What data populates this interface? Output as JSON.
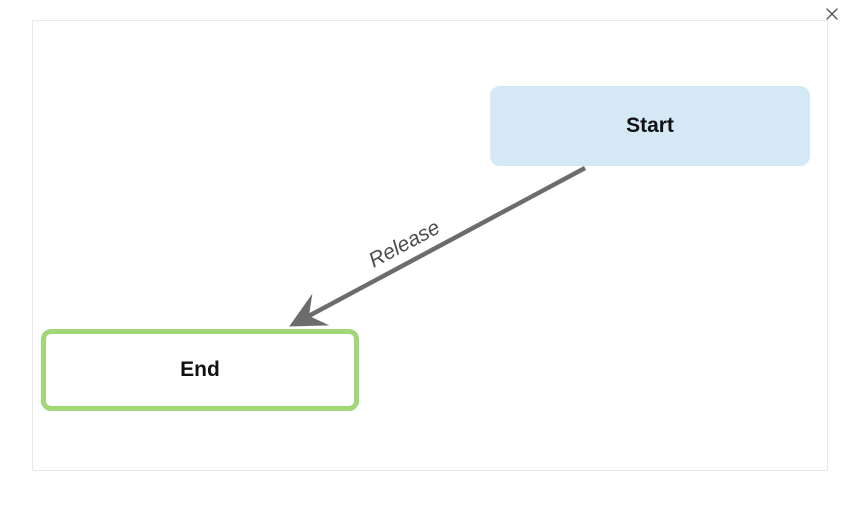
{
  "diagram": {
    "nodes": {
      "start": {
        "label": "Start"
      },
      "end": {
        "label": "End"
      }
    },
    "edge": {
      "label": "Release"
    }
  },
  "chart_data": {
    "type": "flowchart",
    "title": "",
    "nodes": [
      {
        "id": "start",
        "label": "Start",
        "kind": "start",
        "fill": "#d4e9f5",
        "border": "#d4e9f5"
      },
      {
        "id": "end",
        "label": "End",
        "kind": "terminal",
        "fill": "#ffffff",
        "border": "#a1d776",
        "selected": true
      }
    ],
    "edges": [
      {
        "from": "start",
        "to": "end",
        "label": "Release",
        "directed": true
      }
    ]
  }
}
